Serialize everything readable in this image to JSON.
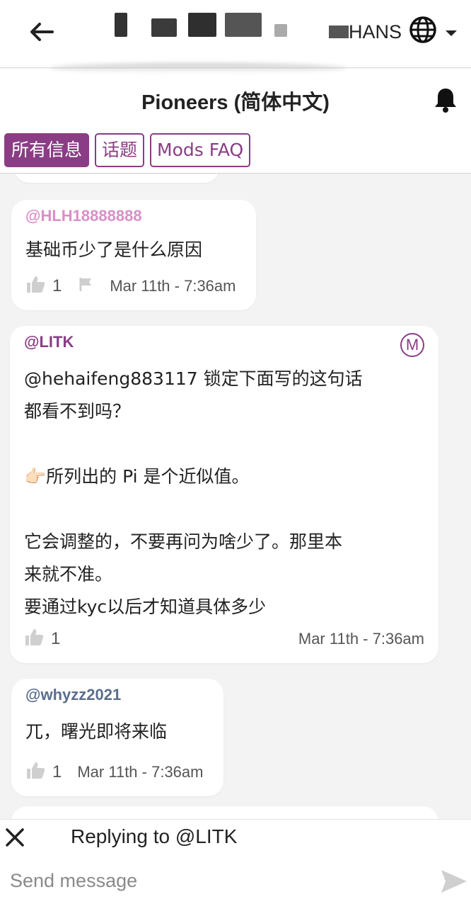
{
  "topbar": {
    "language_label": "HANS"
  },
  "channel": {
    "title": "Pioneers (简体中文)"
  },
  "tabs": [
    {
      "label": "所有信息",
      "active": true
    },
    {
      "label": "话题",
      "active": false
    },
    {
      "label": "Mods FAQ",
      "active": false
    }
  ],
  "messages": [
    {
      "sender": "@HLH18888888",
      "sender_color": "#d98fc7",
      "text": "基础币少了是什么原因",
      "likes": "1",
      "timestamp": "Mar 11th - 7:36am"
    },
    {
      "sender": "@LITK",
      "sender_color": "#8a3d84",
      "moderator_badge": "M",
      "text": "@hehaifeng883117 锁定下面写的这句话\n都看不到吗？\n\n👉🏻所列出的 Pi 是个近似值。\n\n它会调整的，不要再问为啥少了。那里本\n来就不准。\n要通过kyc以后才知道具体多少",
      "likes": "1",
      "timestamp": "Mar 11th - 7:36am"
    },
    {
      "sender": "@whyzz2021",
      "sender_color": "#5a6e8c",
      "text": "兀，曙光即将来临",
      "likes": "1",
      "timestamp": "Mar 11th - 7:36am"
    }
  ],
  "reply": {
    "label": "Replying to @LITK"
  },
  "composer": {
    "placeholder": "Send message"
  },
  "colors": {
    "accent": "#8a3d84"
  }
}
